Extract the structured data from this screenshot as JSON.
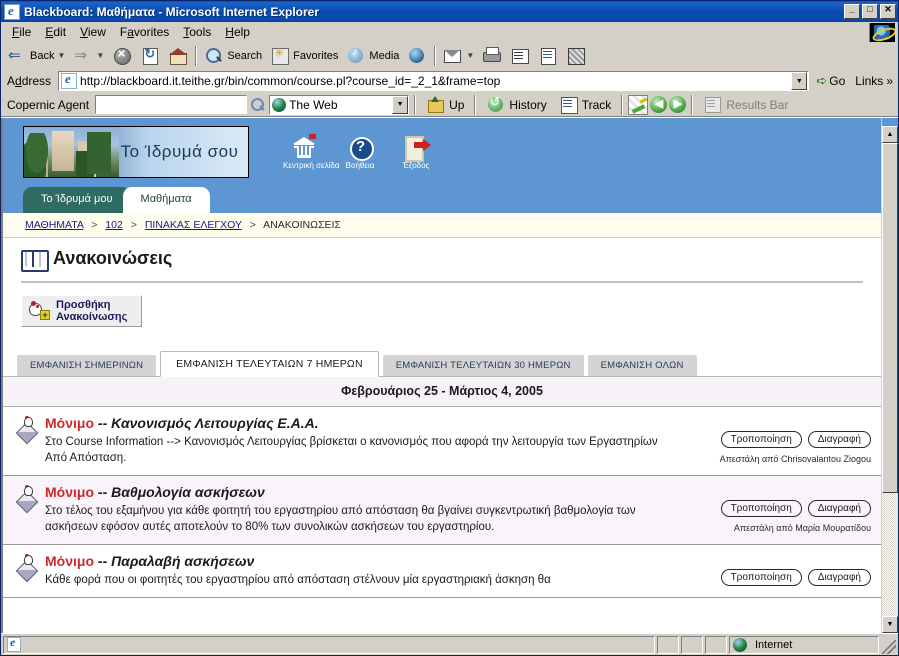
{
  "window": {
    "title": "Blackboard: Μαθήματα - Microsoft Internet Explorer",
    "minimize_label": "_",
    "maximize_label": "□",
    "close_label": "✕"
  },
  "menu": [
    {
      "label": "File"
    },
    {
      "label": "Edit"
    },
    {
      "label": "View"
    },
    {
      "label": "Favorites"
    },
    {
      "label": "Tools"
    },
    {
      "label": "Help"
    }
  ],
  "toolbar": {
    "back_label": "Back",
    "search_label": "Search",
    "favorites_label": "Favorites",
    "media_label": "Media"
  },
  "address": {
    "label": "Address",
    "url": "http://blackboard.it.teithe.gr/bin/common/course.pl?course_id=_2_1&frame=top",
    "go_label": "Go",
    "links_label": "Links"
  },
  "copernic": {
    "label": "Copernic Agent",
    "query": "",
    "scope": "The Web",
    "up_label": "Up",
    "history_label": "History",
    "track_label": "Track",
    "results_bar_label": "Results Bar"
  },
  "blackboard": {
    "logo_text": "Το Ίδρυμά σου",
    "nav_icons": [
      {
        "name": "home-icon",
        "label": "Κεντρική σελίδα"
      },
      {
        "name": "help-icon",
        "label": "Βοήθεια"
      },
      {
        "name": "exit-icon",
        "label": "Έξοδος"
      }
    ],
    "tabs": [
      {
        "label": "Το Ίδρυμά μου",
        "active": false
      },
      {
        "label": "Μαθήματα",
        "active": true
      }
    ],
    "breadcrumb": {
      "items": [
        {
          "label": "ΜΑΘΗΜΑΤΑ",
          "link": true
        },
        {
          "label": "102",
          "link": true
        },
        {
          "label": "ΠΙΝΑΚΑΣ ΕΛΕΓΧΟΥ",
          "link": true
        },
        {
          "label": "ΑΝΑΚΟΙΝΩΣΕΙΣ",
          "link": false
        }
      ],
      "separator": ">"
    },
    "page_title": "Ανακοινώσεις",
    "add_button": {
      "line1": "Προσθήκη",
      "line2": "Ανακοίνωσης"
    },
    "filter_tabs": [
      {
        "label": "ΕΜΦΑΝΙΣΗ ΣΗΜΕΡΙΝΩΝ",
        "active": false
      },
      {
        "label": "ΕΜΦΑΝΙΣΗ ΤΕΛΕΥΤΑΙΩΝ 7 ΗΜΕΡΩΝ",
        "active": true
      },
      {
        "label": "ΕΜΦΑΝΙΣΗ ΤΕΛΕΥΤΑΙΩΝ 30 ΗΜΕΡΩΝ",
        "active": false
      },
      {
        "label": "ΕΜΦΑΝΙΣΗ ΟΛΩΝ",
        "active": false
      }
    ],
    "date_range": "Φεβρουάριος 25 - Μάρτιος 4, 2005",
    "edit_label": "Τροποποίηση",
    "delete_label": "Διαγραφή",
    "sender_prefix": "Απεστάλη από",
    "announcements": [
      {
        "permanent": "Μόνιμο",
        "dash": "--",
        "subject": "Κανονισμός Λειτουργίας Ε.Α.Α.",
        "body": "Στο Course Information --> Κανονισμός Λειτουργίας βρίσκεται ο κανονισμός που αφορά την λειτουργία των Εργαστηρίων Από Απόσταση.",
        "sender": "Chrisovalantou Ziogou"
      },
      {
        "permanent": "Μόνιμο",
        "dash": "--",
        "subject": "Βαθμολογία ασκήσεων",
        "body": "Στο τέλος του εξαμήνου για κάθε φοιτητή του εργαστηρίου από απόσταση θα βγαίνει συγκεντρωτική βαθμολογία των ασκήσεων εφόσον αυτές αποτελούν το 80% των συνολικών ασκήσεων του εργαστηρίου.",
        "sender": "Μαρία Μουρατίδου"
      },
      {
        "permanent": "Μόνιμο",
        "dash": "--",
        "subject": "Παραλαβή ασκήσεων",
        "body": "Κάθε φορά που οι φοιτητές του εργαστηρίου από απόσταση στέλνουν μία εργαστηριακή άσκηση θα",
        "sender": ""
      }
    ]
  },
  "statusbar": {
    "message": "",
    "zone": "Internet"
  },
  "colors": {
    "header_blue": "#5e96d1",
    "tab_teal": "#2f6b63",
    "permanent_red": "#cc2a2a",
    "breadcrumb_bg": "#fdfced",
    "alt_row": "#f9f4f9"
  }
}
